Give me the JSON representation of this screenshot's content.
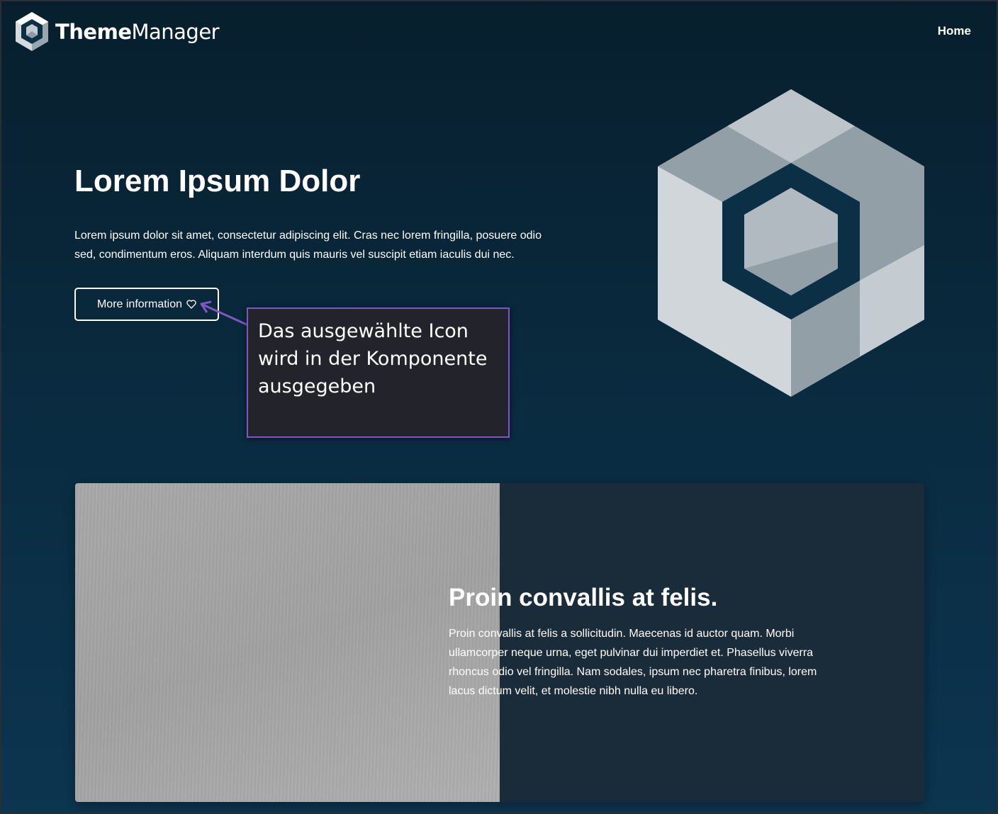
{
  "header": {
    "logo_bold": "Theme",
    "logo_light": "Manager",
    "nav_home": "Home"
  },
  "hero": {
    "title": "Lorem Ipsum Dolor",
    "text": "Lorem ipsum dolor sit amet, consectetur adipiscing elit. Cras nec lorem fringilla, posuere odio sed, condimentum eros. Aliquam interdum quis mauris vel suscipit etiam iaculis dui nec.",
    "button_label": "More information",
    "button_icon": "heart-outline-icon"
  },
  "annotation": {
    "text": "Das ausgewählte Icon wird in der Komponente ausgegeben"
  },
  "card": {
    "title": "Proin convallis at felis.",
    "text": "Proin convallis at felis a sollicitudin. Maecenas id auctor quam. Morbi ullamcorper neque urna, eget pulvinar dui imperdiet et. Phasellus viverra rhoncus odio vel fringilla. Nam sodales, ipsum nec pharetra finibus, lorem lacus dictum velit, et molestie nibh nulla eu libero."
  },
  "colors": {
    "annotation_border": "#7e57c2",
    "annotation_bg": "#22232b",
    "card_bg": "#1a2c3a"
  }
}
